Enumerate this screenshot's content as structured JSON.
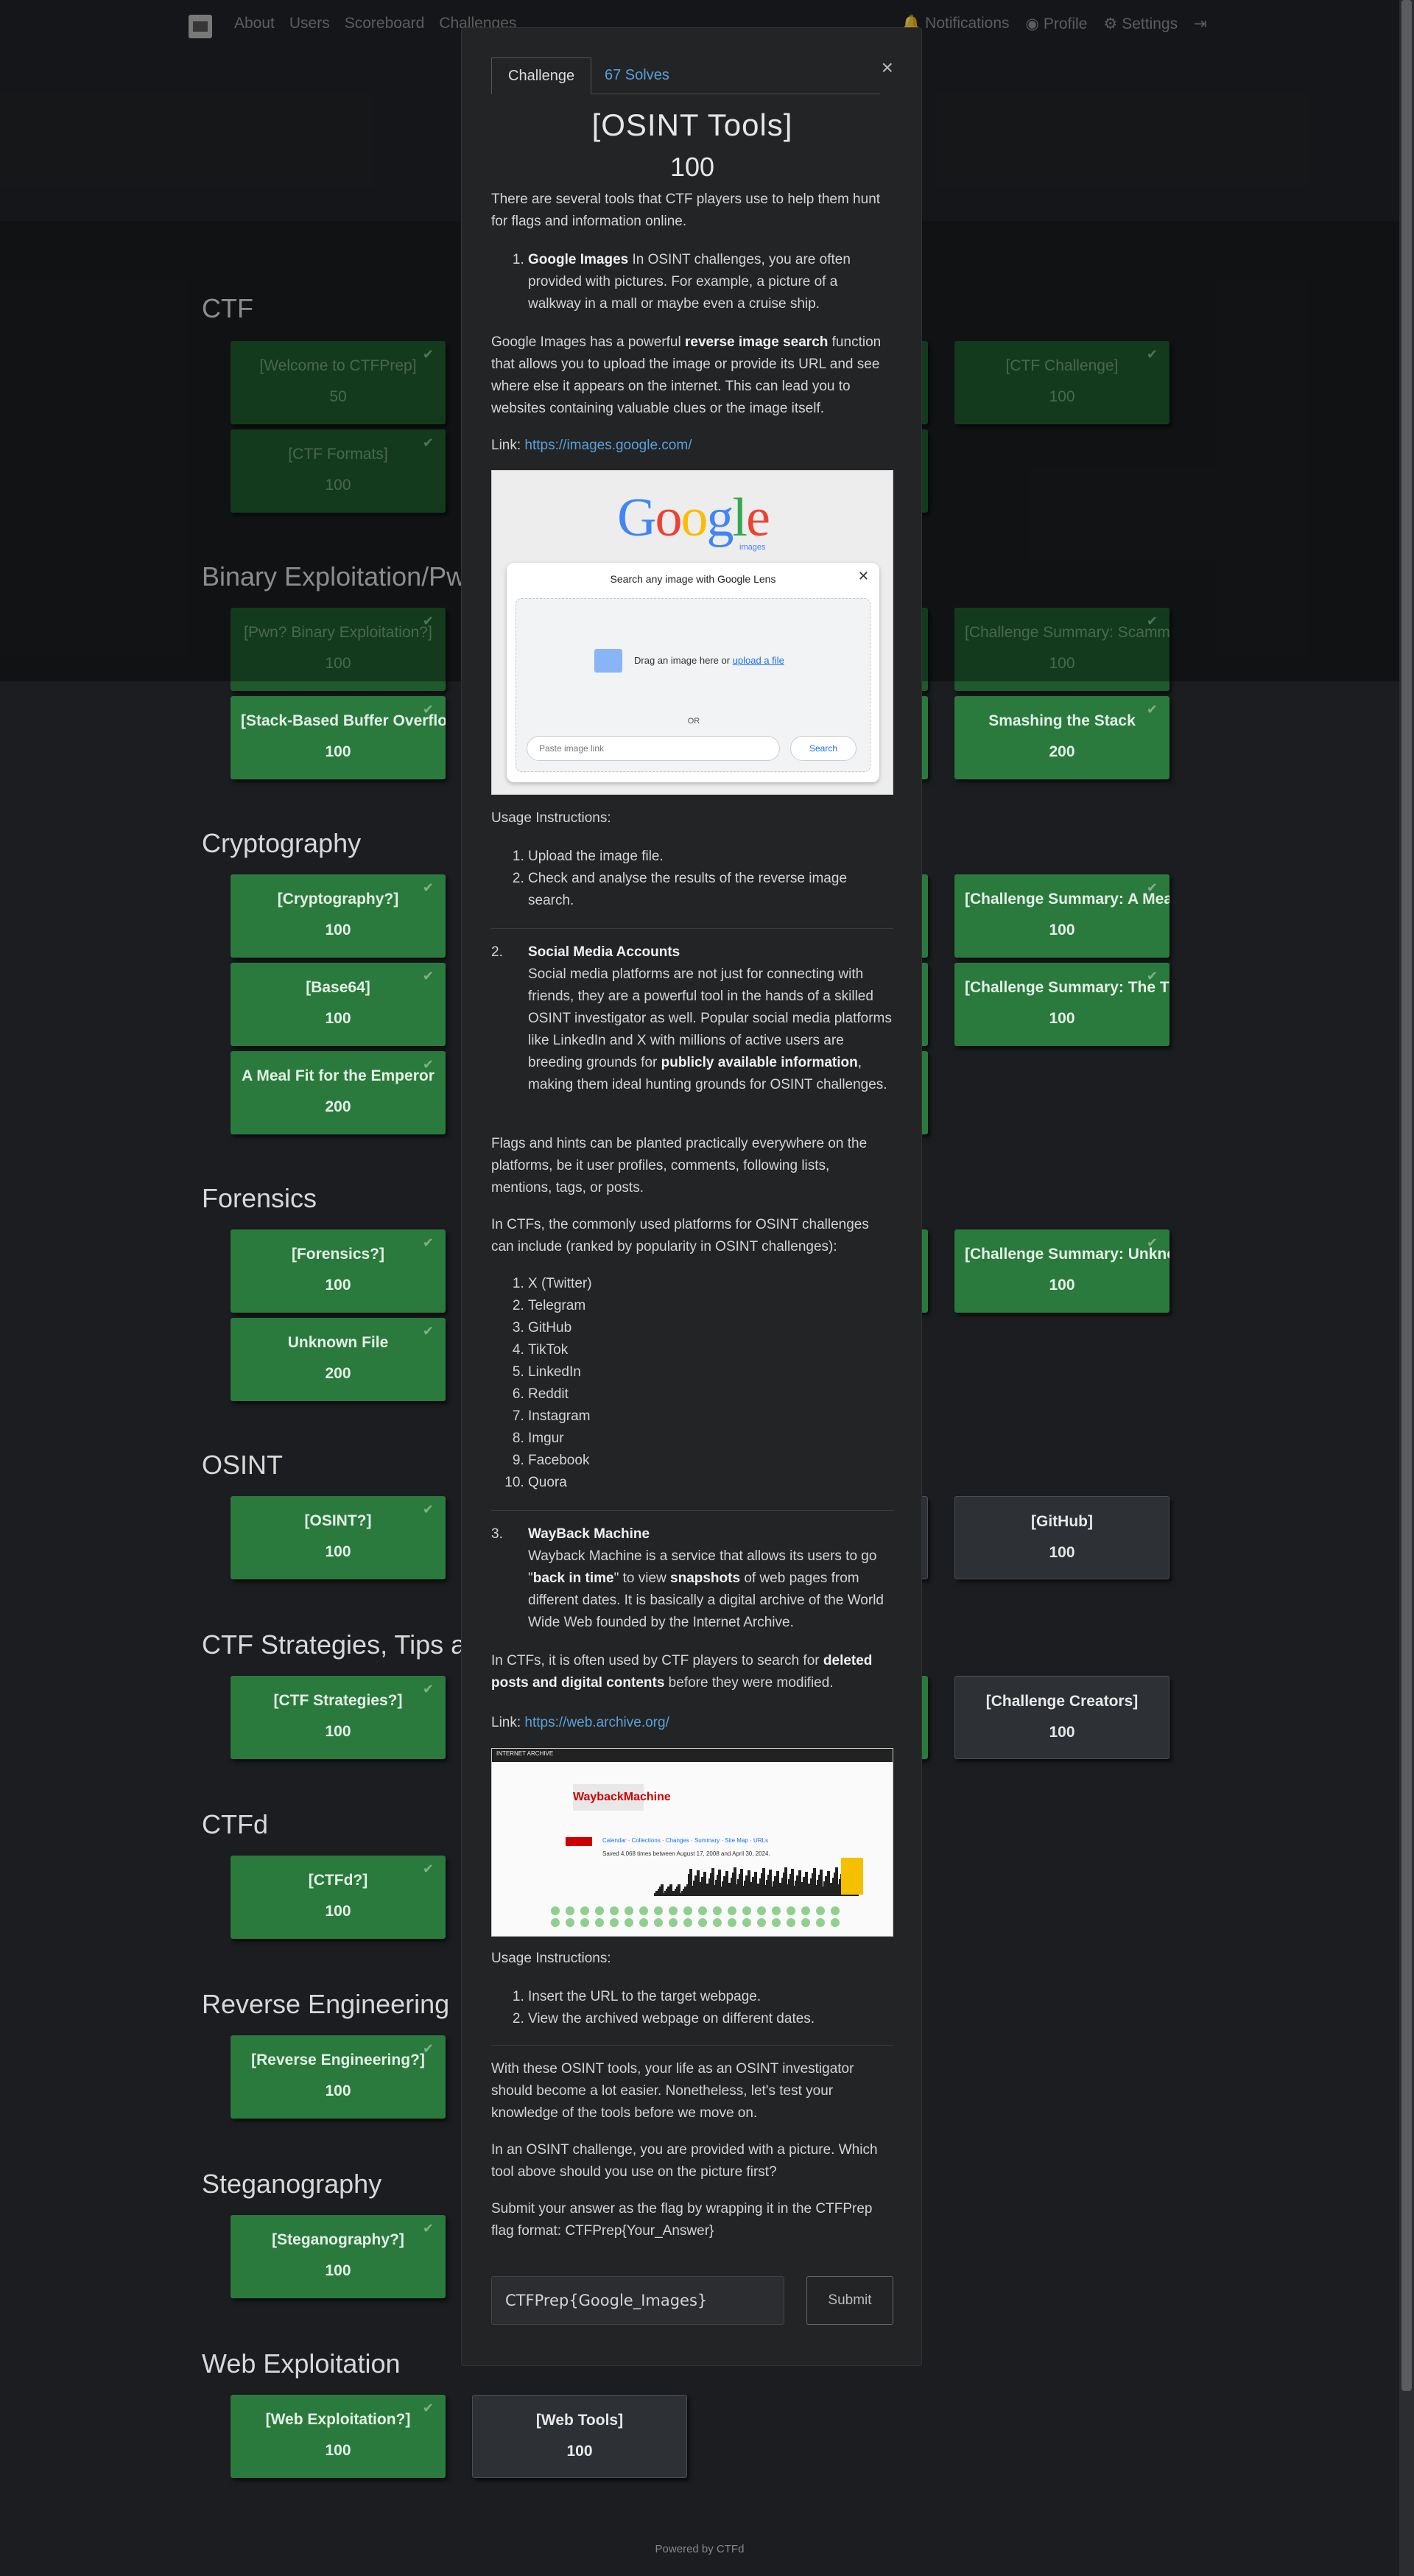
{
  "nav": {
    "left": [
      "About",
      "Users",
      "Scoreboard",
      "Challenges"
    ],
    "right": [
      "Notifications",
      "Profile",
      "Settings"
    ]
  },
  "categories": [
    {
      "name": "CTF",
      "cards": [
        {
          "name": "[Welcome to CTFPrep]",
          "points": "50",
          "solved": true
        },
        {
          "name": "[CTF Challenge]",
          "points": "100",
          "solved": true
        },
        {
          "name": "[CTF Formats]",
          "points": "100",
          "solved": true
        }
      ]
    },
    {
      "name": "Binary Exploitation/Pwn",
      "cards": [
        {
          "name": "[Pwn? Binary Exploitation?]",
          "points": "100",
          "solved": true
        },
        {
          "name": "[Challenge Summary: Scamming]",
          "points": "100",
          "solved": true
        },
        {
          "name": "[Stack-Based Buffer Overflow]",
          "points": "100",
          "solved": true
        },
        {
          "name": "Smashing the Stack",
          "points": "200",
          "solved": true
        }
      ]
    },
    {
      "name": "Cryptography",
      "cards": [
        {
          "name": "[Cryptography?]",
          "points": "100",
          "solved": true
        },
        {
          "name": "[Challenge Summary: A Meal Fit]",
          "points": "100",
          "solved": true
        },
        {
          "name": "[Base64]",
          "points": "100",
          "solved": true
        },
        {
          "name": "[Challenge Summary: The Trek]",
          "points": "100",
          "solved": true
        },
        {
          "name": "A Meal Fit for the Emperor",
          "points": "200",
          "solved": true
        }
      ]
    },
    {
      "name": "Forensics",
      "cards": [
        {
          "name": "[Forensics?]",
          "points": "100",
          "solved": true
        },
        {
          "name": "[Challenge Summary: Unknown]",
          "points": "100",
          "solved": true
        },
        {
          "name": "Unknown File",
          "points": "200",
          "solved": true
        }
      ]
    },
    {
      "name": "OSINT",
      "cards": [
        {
          "name": "[OSINT?]",
          "points": "100",
          "solved": true
        },
        {
          "name": "[GitHub]",
          "points": "100",
          "solved": false
        }
      ]
    },
    {
      "name": "CTF Strategies, Tips and",
      "cards": [
        {
          "name": "[CTF Strategies?]",
          "points": "100",
          "solved": true
        },
        {
          "name": "[Challenge Creators]",
          "points": "100",
          "solved": false
        }
      ]
    },
    {
      "name": "CTFd",
      "cards": [
        {
          "name": "[CTFd?]",
          "points": "100",
          "solved": true
        }
      ]
    },
    {
      "name": "Reverse Engineering",
      "cards": [
        {
          "name": "[Reverse Engineering?]",
          "points": "100",
          "solved": true
        }
      ]
    },
    {
      "name": "Steganography",
      "cards": [
        {
          "name": "[Steganography?]",
          "points": "100",
          "solved": true
        }
      ]
    },
    {
      "name": "Web Exploitation",
      "cards": [
        {
          "name": "[Web Exploitation?]",
          "points": "100",
          "solved": true
        },
        {
          "name": "[Web Tools]",
          "points": "100",
          "solved": false
        }
      ]
    }
  ],
  "modal": {
    "tab_challenge": "Challenge",
    "tab_solves": "67 Solves",
    "close": "×",
    "title": "[OSINT Tools]",
    "value": "100",
    "intro": "There are several tools that CTF players use to help them hunt for flags and information online.",
    "item1_title": "Google Images",
    "item1_text": " In OSINT challenges, you are often provided with pictures. For example, a picture of a walkway in a mall or maybe even a cruise ship.",
    "gi_pre": "Google Images has a powerful ",
    "gi_bold": "reverse image search",
    "gi_post": " function that allows you to upload the image or provide its URL and see where else it appears on the internet. This can lead you to websites containing valuable clues or the image itself.",
    "link_label": "Link: ",
    "link1": "https://images.google.com/",
    "shot1": {
      "images": "images",
      "dialog_title": "Search any image with Google Lens",
      "drag_text": "Drag an image here or ",
      "upload": "upload a file",
      "or": "OR",
      "paste": "Paste image link",
      "search": "Search"
    },
    "usage": "Usage Instructions:",
    "usage1": [
      "Upload the image file.",
      "Check and analyse the results of the reverse image search."
    ],
    "item2_num": "2.",
    "item2_title": "Social Media Accounts",
    "sm_pre": "Social media platforms are not just for connecting with friends, they are a powerful tool in the hands of a skilled OSINT investigator as well. Popular social media platforms like LinkedIn and X with millions of active users are breeding grounds for ",
    "sm_bold": "publicly available information",
    "sm_post": ", making them ideal hunting grounds for OSINT challenges.",
    "flags_text": "Flags and hints can be planted practically everywhere on the platforms, be it user profiles, comments, following lists, mentions, tags, or posts.",
    "ctfs_text": "In CTFs, the commonly used platforms for OSINT challenges can include (ranked by popularity in OSINT challenges):",
    "platforms": [
      "X (Twitter)",
      "Telegram",
      "GitHub",
      "TikTok",
      "LinkedIn",
      "Reddit",
      "Instagram",
      "Imgur",
      "Facebook",
      "Quora"
    ],
    "item3_num": "3.",
    "item3_title": "WayBack Machine",
    "wb_a": "Wayback Machine is a service that allows its users to go \"",
    "wb_b": "back in time",
    "wb_c": "\" to view ",
    "wb_d": "snapshots",
    "wb_e": " of web pages from different dates. It is basically a digital archive of the World Wide Web founded by the Internet Archive.",
    "wb2_pre": "In CTFs, it is often used by CTF players to search for ",
    "wb2_bold": "deleted posts and digital contents",
    "wb2_post": " before they were modified.",
    "link2": "https://web.archive.org/",
    "shot2": {
      "header": "INTERNET ARCHIVE",
      "logo": "WaybackMachine",
      "tabs": "Calendar · Collections · Changes · Summary · Site Map · URLs",
      "saved": "Saved 4,068 times between August 17, 2008 and April 30, 2024."
    },
    "usage2": [
      "Insert the URL to the target webpage.",
      "View the archived webpage on different dates."
    ],
    "outro1": "With these OSINT tools, your life as an OSINT investigator should become a lot easier. Nonetheless, let's test your knowledge of the tools before we move on.",
    "outro2": "In an OSINT challenge, you are provided with a picture. Which tool above should you use on the picture first?",
    "outro3": "Submit your answer as the flag by wrapping it in the CTFPrep flag format: CTFPrep{Your_Answer}",
    "answer_value": "CTFPrep{Google_Images}",
    "submit": "Submit"
  },
  "footer": "Powered by CTFd"
}
